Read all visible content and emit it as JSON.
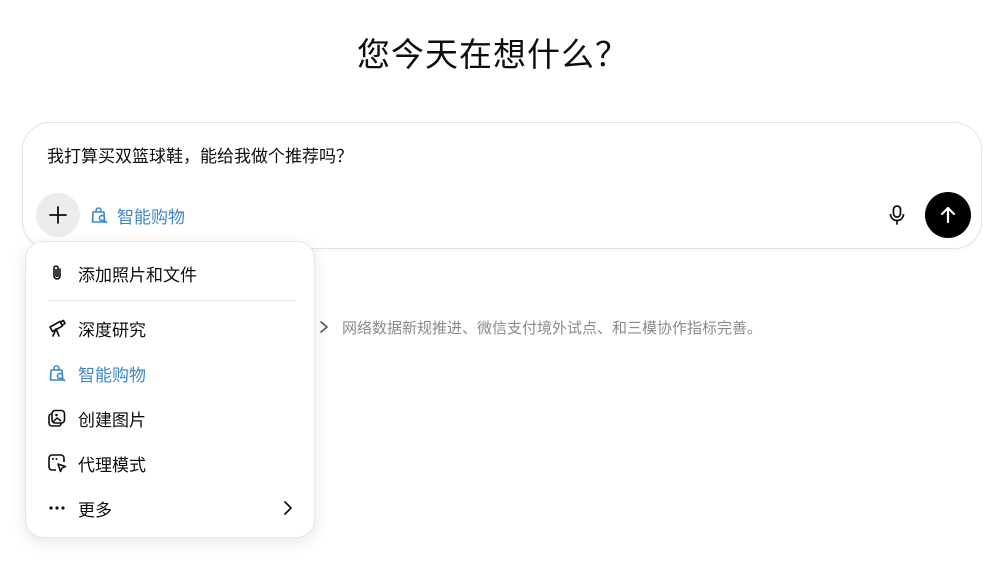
{
  "heading": "您今天在想什么？",
  "composer": {
    "prompt_text": "我打算买双篮球鞋，能给我做个推荐吗？",
    "active_tool_label": "智能购物",
    "plus_icon": "plus-icon",
    "mic_icon": "microphone-icon",
    "send_icon": "arrow-up-icon"
  },
  "background_row": {
    "text": "网络数据新规推进、微信支付境外试点、和三模协作指标完善。"
  },
  "menu": {
    "items": [
      {
        "label": "添加照片和文件",
        "icon": "paperclip-icon"
      },
      {
        "label": "深度研究",
        "icon": "telescope-icon"
      },
      {
        "label": "智能购物",
        "icon": "shopping-bag-search-icon",
        "active": true
      },
      {
        "label": "创建图片",
        "icon": "image-create-icon"
      },
      {
        "label": "代理模式",
        "icon": "agent-cursor-icon"
      },
      {
        "label": "更多",
        "icon": "more-dots-icon"
      }
    ]
  },
  "colors": {
    "accent": "#3f86c8",
    "send_button": "#000000",
    "plus_button_bg": "#ececec",
    "muted_text": "#8a8a8a"
  }
}
